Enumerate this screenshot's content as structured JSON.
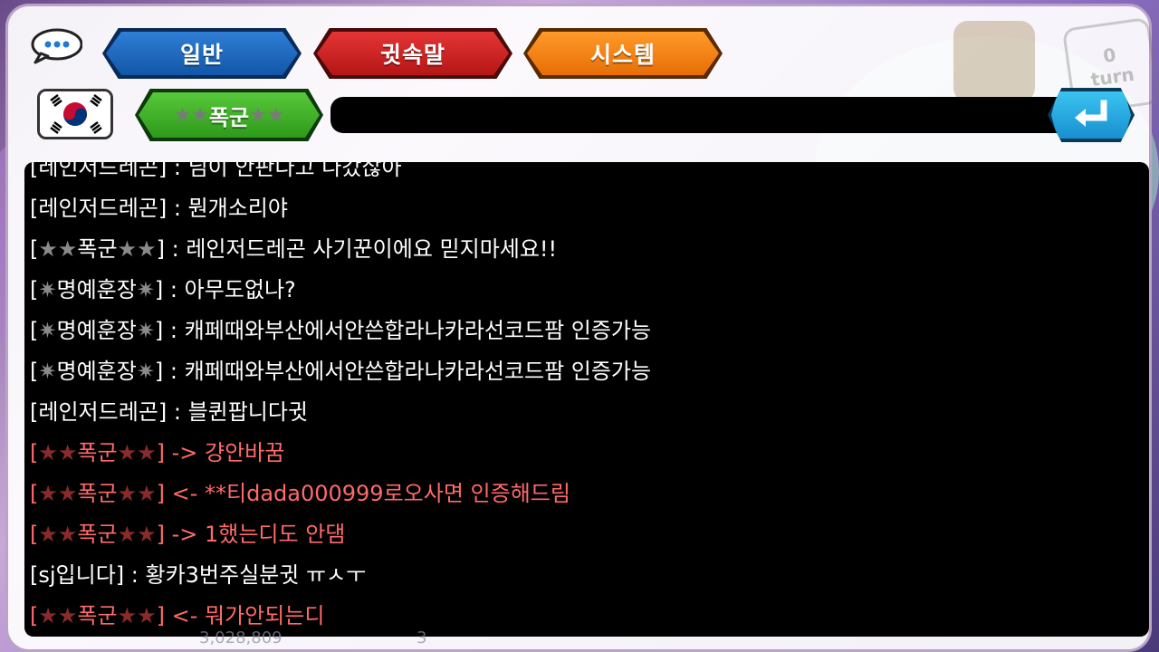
{
  "tabs": {
    "general": "일반",
    "whisper": "귓속말",
    "system": "시스템"
  },
  "target": {
    "stars_left": "★★",
    "name": "폭군",
    "stars_right": "★★"
  },
  "input": {
    "value": ""
  },
  "background": {
    "turn_top": "0",
    "turn_label": "turn",
    "gold": "3,028,809",
    "count": "3"
  },
  "messages": [
    {
      "prefix": "[",
      "icon_l": "",
      "name": "레인저드레곤",
      "icon_r": "",
      "suffix": "] : 님이 안판다고 나갔잖아",
      "type": "normal"
    },
    {
      "prefix": "[",
      "icon_l": "",
      "name": "레인저드레곤",
      "icon_r": "",
      "suffix": "] : 뭔개소리야",
      "type": "normal"
    },
    {
      "prefix": "[",
      "icon_l": "★★",
      "name": "폭군",
      "icon_r": "★★",
      "suffix": "] : 레인저드레곤 사기꾼이에요 믿지마세요!!",
      "type": "normal"
    },
    {
      "prefix": "[",
      "icon_l": "✷",
      "name": "명예훈장",
      "icon_r": "✷",
      "suffix": "] : 아무도없나?",
      "type": "normal"
    },
    {
      "prefix": "[",
      "icon_l": "✷",
      "name": "명예훈장",
      "icon_r": "✷",
      "suffix": "] : 캐페때와부산에서안쓴합라나카라선코드팜 인증가능",
      "type": "normal"
    },
    {
      "prefix": "[",
      "icon_l": "✷",
      "name": "명예훈장",
      "icon_r": "✷",
      "suffix": "] : 캐페때와부산에서안쓴합라나카라선코드팜 인증가능",
      "type": "normal"
    },
    {
      "prefix": "[",
      "icon_l": "",
      "name": "레인저드레곤",
      "icon_r": "",
      "suffix": "] : 블퀸팝니다귓",
      "type": "normal"
    },
    {
      "prefix": "[",
      "icon_l": "★★",
      "name": "폭군",
      "icon_r": "★★",
      "suffix": "] -> 걍안바꿈",
      "type": "whisper"
    },
    {
      "prefix": "[",
      "icon_l": "★★",
      "name": "폭군",
      "icon_r": "★★",
      "suffix": "] <- **티dada000999로오사면 인증해드림",
      "type": "whisper"
    },
    {
      "prefix": "[",
      "icon_l": "★★",
      "name": "폭군",
      "icon_r": "★★",
      "suffix": "] -> 1했는디도 안댐",
      "type": "whisper"
    },
    {
      "prefix": "[",
      "icon_l": "",
      "name": "sj입니다",
      "icon_r": "",
      "suffix": "] : 황카3번주실분귓 ㅠㅅㅜ",
      "type": "normal"
    },
    {
      "prefix": "[",
      "icon_l": "★★",
      "name": "폭군",
      "icon_r": "★★",
      "suffix": "] <- 뭐가안되는디",
      "type": "whisper"
    }
  ]
}
